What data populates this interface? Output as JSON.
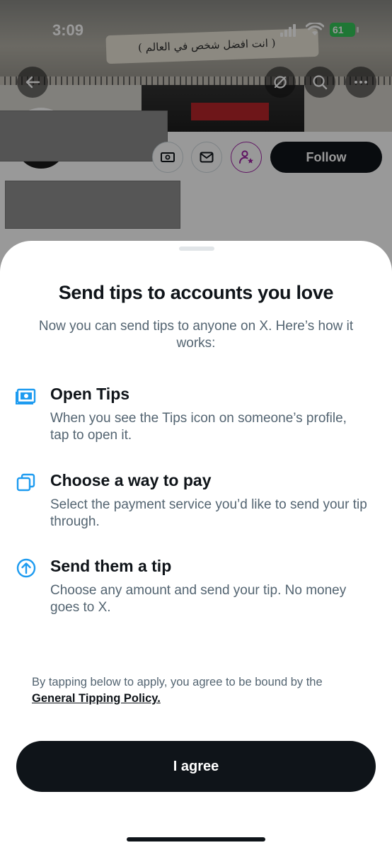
{
  "status_bar": {
    "time": "3:09",
    "battery": "61"
  },
  "banner": {
    "paper_text": "( انت افضل شخص في العالم )"
  },
  "profile": {
    "follow_label": "Follow"
  },
  "sheet": {
    "title": "Send tips to accounts you love",
    "subtitle": "Now you can send tips to anyone on X. Here’s how it works:",
    "steps": [
      {
        "icon": "money-icon",
        "title": "Open Tips",
        "description": "When you see the Tips icon on someone’s profile, tap to open it."
      },
      {
        "icon": "copy-windows-icon",
        "title": "Choose a way to pay",
        "description": "Select the payment service you’d like to send your tip through."
      },
      {
        "icon": "arrow-up-circle-icon",
        "title": "Send them a tip",
        "description": "Choose any amount and send your tip. No money goes to X."
      }
    ],
    "policy_prefix": "By tapping below to apply, you agree to be bound by the ",
    "policy_link": "General Tipping Policy.",
    "agree_label": "I agree"
  },
  "colors": {
    "accent": "#1d9bf0",
    "primary_button": "#0f1419",
    "secondary_text": "#536471",
    "battery": "#34c759"
  }
}
